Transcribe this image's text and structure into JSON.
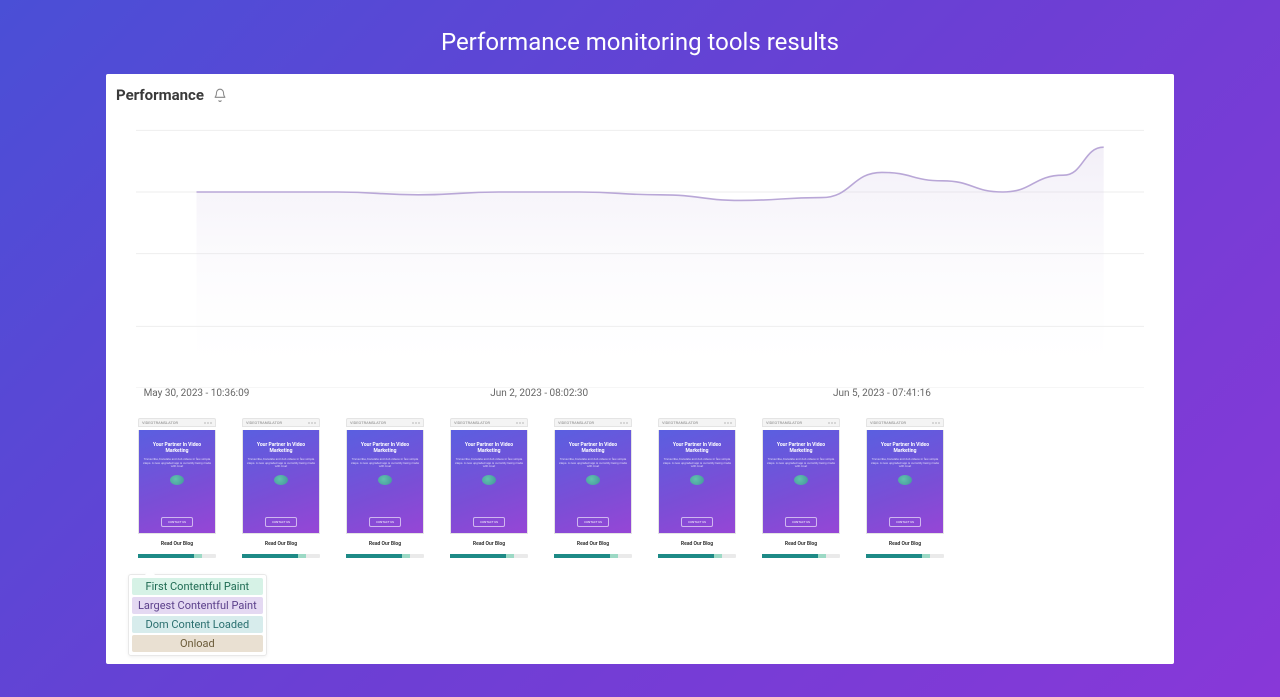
{
  "page": {
    "title": "Performance monitoring tools results"
  },
  "panel": {
    "title": "Performance"
  },
  "chart_data": {
    "type": "area",
    "title": "",
    "xlabel": "",
    "ylabel": "",
    "x_ticks": [
      "May 30, 2023 - 10:36:09",
      "Jun 2, 2023 - 08:02:30",
      "Jun 5, 2023 - 07:41:16"
    ],
    "x_tick_positions_pct": [
      6,
      40,
      74
    ],
    "ylim": [
      0,
      100
    ],
    "grid_y_pct": [
      8,
      30,
      52,
      78,
      100
    ],
    "series": [
      {
        "name": "Performance",
        "color": "#b9a7d7",
        "fill": "rgba(185,167,215,0.18)",
        "x_pct": [
          6,
          12,
          20,
          28,
          36,
          44,
          52,
          60,
          68,
          74,
          80,
          86,
          92,
          96
        ],
        "y_val": [
          70,
          70,
          70,
          69,
          70,
          70,
          69,
          67,
          68,
          77,
          74,
          70,
          76,
          86
        ]
      }
    ]
  },
  "thumbnails": {
    "brand": "VIDEOTRANSLATOR",
    "hero_title": "Your Partner In Video Marketing",
    "hero_sub": "Transcribe, translate and dub videos in few simple steps. A new upgraded app is currently being made with love!",
    "hero_cta": "CONTACT US",
    "footer": "Read Our Blog",
    "count": 8
  },
  "legend": {
    "items": [
      {
        "label": "First Contentful Paint",
        "bg": "#d6f2e6",
        "fg": "#1f6b53"
      },
      {
        "label": "Largest Contentful Paint",
        "bg": "#e4d9f2",
        "fg": "#5a3f8a"
      },
      {
        "label": "Dom Content Loaded",
        "bg": "#d7ecec",
        "fg": "#2a6f6f"
      },
      {
        "label": "Onload",
        "bg": "#e9e0d2",
        "fg": "#6a5a38"
      }
    ]
  }
}
